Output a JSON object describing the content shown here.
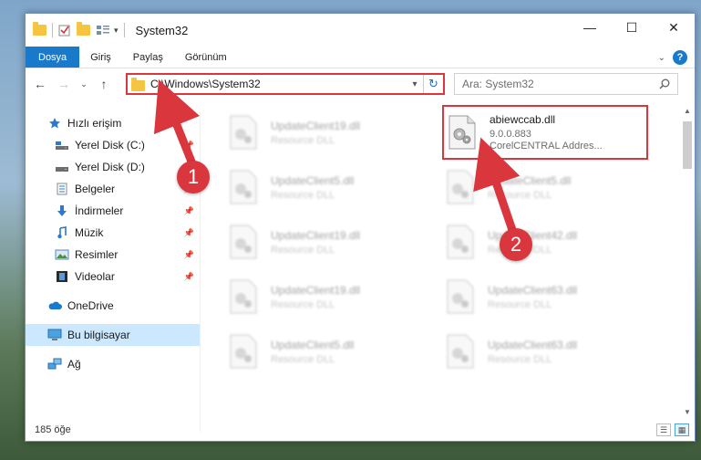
{
  "window": {
    "title": "System32",
    "controls": {
      "minimize": "—",
      "maximize": "☐",
      "close": "✕"
    }
  },
  "ribbon": {
    "tabs": [
      "Dosya",
      "Giriş",
      "Paylaş",
      "Görünüm"
    ],
    "help": "?"
  },
  "address": {
    "path": "C:\\Windows\\System32"
  },
  "search": {
    "placeholder": "Ara: System32"
  },
  "sidebar": {
    "quick_access": "Hızlı erişim",
    "items": [
      {
        "label": "Yerel Disk (C:)",
        "icon": "drive-icon",
        "pinned": true
      },
      {
        "label": "Yerel Disk (D:)",
        "icon": "drive-icon",
        "pinned": false
      },
      {
        "label": "Belgeler",
        "icon": "documents-icon",
        "pinned": true
      },
      {
        "label": "İndirmeler",
        "icon": "download-icon",
        "pinned": true
      },
      {
        "label": "Müzik",
        "icon": "music-icon",
        "pinned": true
      },
      {
        "label": "Resimler",
        "icon": "pictures-icon",
        "pinned": true
      },
      {
        "label": "Videolar",
        "icon": "videos-icon",
        "pinned": true
      }
    ],
    "onedrive": "OneDrive",
    "this_pc": "Bu bilgisayar",
    "network": "Ağ"
  },
  "files": {
    "left": [
      {
        "name": "UpdateClient19.dll",
        "desc": "Resource DLL"
      },
      {
        "name": "UpdateClient5.dll",
        "desc": "Resource DLL"
      },
      {
        "name": "UpdateClient19.dll",
        "desc": "Resource DLL"
      },
      {
        "name": "UpdateClient19.dll",
        "desc": "Resource DLL"
      },
      {
        "name": "UpdateClient5.dll",
        "desc": "Resource DLL"
      }
    ],
    "right": [
      {
        "name": "abiewccab.dll",
        "version": "9.0.0.883",
        "desc": "CorelCENTRAL Addres..."
      },
      {
        "name": "UpdateClient5.dll",
        "desc": "Resource DLL"
      },
      {
        "name": "UpdateClient42.dll",
        "desc": "Resource DLL"
      },
      {
        "name": "UpdateClient63.dll",
        "desc": "Resource DLL"
      },
      {
        "name": "UpdateClient63.dll",
        "desc": "Resource DLL"
      }
    ]
  },
  "status": {
    "count": "185 öğe"
  },
  "annotations": {
    "step1": "1",
    "step2": "2"
  },
  "colors": {
    "accent": "#1979ca",
    "highlight": "#d9363e",
    "selected": "#cce8ff"
  }
}
